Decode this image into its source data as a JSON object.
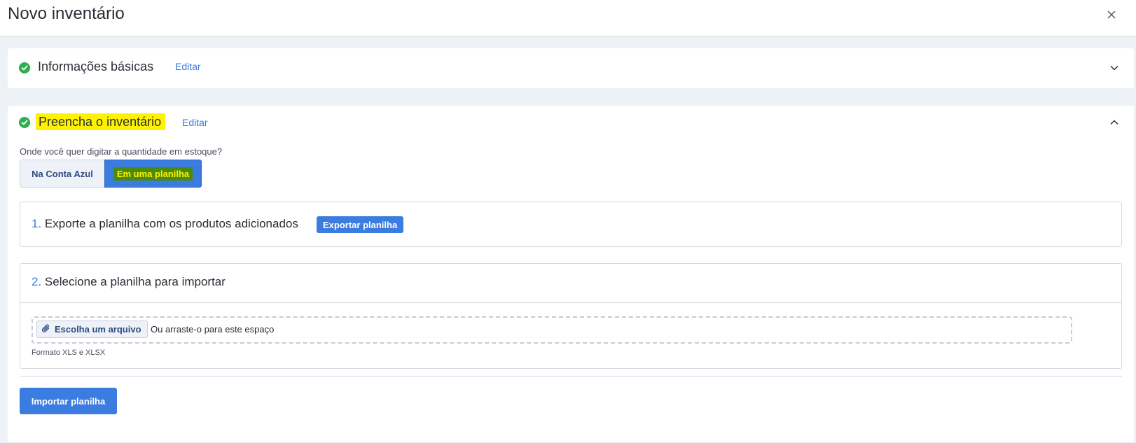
{
  "header": {
    "title": "Novo inventário",
    "close_icon": "close-icon"
  },
  "basic_info": {
    "title": "Informações básicas",
    "edit_label": "Editar",
    "status_icon": "check-circle-icon",
    "toggle_icon": "chevron-down-icon"
  },
  "fill_inventory": {
    "title": "Preencha o inventário",
    "edit_label": "Editar",
    "status_icon": "check-circle-icon",
    "toggle_icon": "chevron-up-icon",
    "question": "Onde você quer digitar a quantidade em estoque?",
    "options": {
      "left": "Na Conta Azul",
      "right": "Em uma planilha",
      "selected": "Em uma planilha"
    },
    "step1": {
      "number": "1.",
      "title": "Exporte a planilha com os produtos adicionados",
      "button": "Exportar planilha"
    },
    "step2": {
      "number": "2.",
      "title": "Selecione a planilha para importar",
      "choose_button": "Escolha um arquivo",
      "drop_text": "Ou arraste-o para este espaço",
      "format": "Formato XLS e XLSX"
    },
    "import_button": "Importar planilha"
  },
  "colors": {
    "accent": "#3b7ce0",
    "success": "#2fae4e",
    "highlight": "#fff200",
    "background": "#eef1f6"
  }
}
